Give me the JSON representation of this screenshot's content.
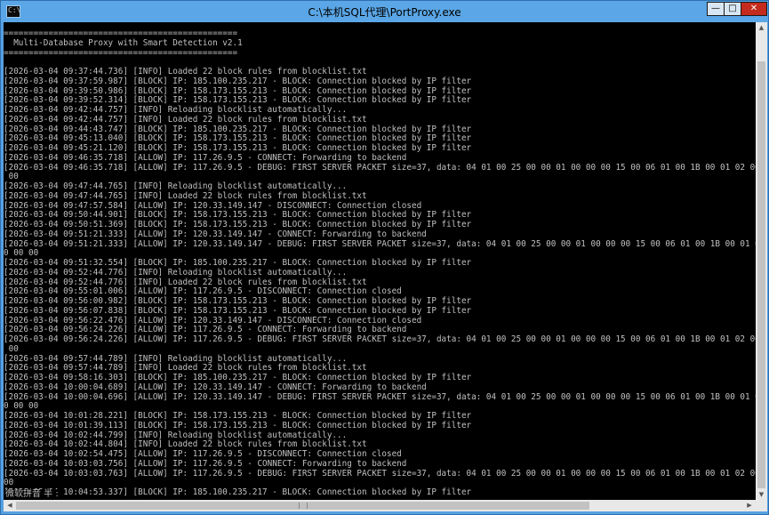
{
  "window": {
    "title": "C:\\本机SQL代理\\PortProxy.exe",
    "minimize_glyph": "—",
    "maximize_glyph": "□",
    "close_glyph": "✕",
    "icon": "console-app-icon",
    "icon_glyph": "C:\\"
  },
  "console": {
    "lines": [
      "===============================================",
      "  Multi-Database Proxy with Smart Detection v2.1",
      "===============================================",
      "",
      "[2026-03-04 09:37:44.736] [INFO] Loaded 22 block rules from blocklist.txt",
      "[2026-03-04 09:37:59.987] [BLOCK] IP: 185.100.235.217 - BLOCK: Connection blocked by IP filter",
      "[2026-03-04 09:39:50.986] [BLOCK] IP: 158.173.155.213 - BLOCK: Connection blocked by IP filter",
      "[2026-03-04 09:39:52.314] [BLOCK] IP: 158.173.155.213 - BLOCK: Connection blocked by IP filter",
      "[2026-03-04 09:42:44.757] [INFO] Reloading blocklist automatically...",
      "[2026-03-04 09:42:44.757] [INFO] Loaded 22 block rules from blocklist.txt",
      "[2026-03-04 09:44:43.747] [BLOCK] IP: 185.100.235.217 - BLOCK: Connection blocked by IP filter",
      "[2026-03-04 09:45:13.040] [BLOCK] IP: 158.173.155.213 - BLOCK: Connection blocked by IP filter",
      "[2026-03-04 09:45:21.120] [BLOCK] IP: 158.173.155.213 - BLOCK: Connection blocked by IP filter",
      "[2026-03-04 09:46:35.718] [ALLOW] IP: 117.26.9.5 - CONNECT: Forwarding to backend",
      "[2026-03-04 09:46:35.718] [ALLOW] IP: 117.26.9.5 - DEBUG: FIRST SERVER PACKET size=37, data: 04 01 00 25 00 00 01 00 00 00 15 00 06 01 00 1B 00 01 02 00 1C 0",
      " 00",
      "[2026-03-04 09:47:44.765] [INFO] Reloading blocklist automatically...",
      "[2026-03-04 09:47:44.765] [INFO] Loaded 22 block rules from blocklist.txt",
      "[2026-03-04 09:47:57.584] [ALLOW] IP: 120.33.149.147 - DISCONNECT: Connection closed",
      "[2026-03-04 09:50:44.901] [BLOCK] IP: 158.173.155.213 - BLOCK: Connection blocked by IP filter",
      "[2026-03-04 09:50:51.369] [BLOCK] IP: 158.173.155.213 - BLOCK: Connection blocked by IP filter",
      "[2026-03-04 09:51:21.333] [ALLOW] IP: 120.33.149.147 - CONNECT: Forwarding to backend",
      "[2026-03-04 09:51:21.333] [ALLOW] IP: 120.33.149.147 - DEBUG: FIRST SERVER PACKET size=37, data: 04 01 00 25 00 00 01 00 00 00 15 00 06 01 00 1B 00 01 02 00",
      "0 00 00",
      "[2026-03-04 09:51:32.554] [BLOCK] IP: 185.100.235.217 - BLOCK: Connection blocked by IP filter",
      "[2026-03-04 09:52:44.776] [INFO] Reloading blocklist automatically...",
      "[2026-03-04 09:52:44.776] [INFO] Loaded 22 block rules from blocklist.txt",
      "[2026-03-04 09:55:01.006] [ALLOW] IP: 117.26.9.5 - DISCONNECT: Connection closed",
      "[2026-03-04 09:56:00.982] [BLOCK] IP: 158.173.155.213 - BLOCK: Connection blocked by IP filter",
      "[2026-03-04 09:56:07.838] [BLOCK] IP: 158.173.155.213 - BLOCK: Connection blocked by IP filter",
      "[2026-03-04 09:56:22.476] [ALLOW] IP: 120.33.149.147 - DISCONNECT: Connection closed",
      "[2026-03-04 09:56:24.226] [ALLOW] IP: 117.26.9.5 - CONNECT: Forwarding to backend",
      "[2026-03-04 09:56:24.226] [ALLOW] IP: 117.26.9.5 - DEBUG: FIRST SERVER PACKET size=37, data: 04 01 00 25 00 00 01 00 00 00 15 00 06 01 00 1B 00 01 02 00 1C 0",
      " 00",
      "[2026-03-04 09:57:44.789] [INFO] Reloading blocklist automatically...",
      "[2026-03-04 09:57:44.789] [INFO] Loaded 22 block rules from blocklist.txt",
      "[2026-03-04 09:58:16.303] [BLOCK] IP: 185.100.235.217 - BLOCK: Connection blocked by IP filter",
      "[2026-03-04 10:00:04.689] [ALLOW] IP: 120.33.149.147 - CONNECT: Forwarding to backend",
      "[2026-03-04 10:00:04.696] [ALLOW] IP: 120.33.149.147 - DEBUG: FIRST SERVER PACKET size=37, data: 04 01 00 25 00 00 01 00 00 00 15 00 06 01 00 1B 00 01 02 00",
      "0 00 00",
      "[2026-03-04 10:01:28.221] [BLOCK] IP: 158.173.155.213 - BLOCK: Connection blocked by IP filter",
      "[2026-03-04 10:01:39.113] [BLOCK] IP: 158.173.155.213 - BLOCK: Connection blocked by IP filter",
      "[2026-03-04 10:02:44.799] [INFO] Reloading blocklist automatically...",
      "[2026-03-04 10:02:44.804] [INFO] Loaded 22 block rules from blocklist.txt",
      "[2026-03-04 10:02:54.475] [ALLOW] IP: 117.26.9.5 - DISCONNECT: Connection closed",
      "[2026-03-04 10:03:03.756] [ALLOW] IP: 117.26.9.5 - CONNECT: Forwarding to backend",
      "[2026-03-04 10:03:03.763] [ALLOW] IP: 117.26.9.5 - DEBUG: FIRST SERVER PACKET size=37, data: 04 01 00 25 00 00 01 00 00 00 15 00 06 01 00 1B 00 01 02 00 1C 0",
      "00",
      "[2026-03-04 10:04:53.337] [BLOCK] IP: 185.100.235.217 - BLOCK: Connection blocked by IP filter"
    ]
  },
  "ime": {
    "text": "微软拼音 半 :"
  },
  "scrollbars": {
    "up_glyph": "▲",
    "down_glyph": "▼",
    "left_glyph": "◀",
    "right_glyph": "▶"
  }
}
